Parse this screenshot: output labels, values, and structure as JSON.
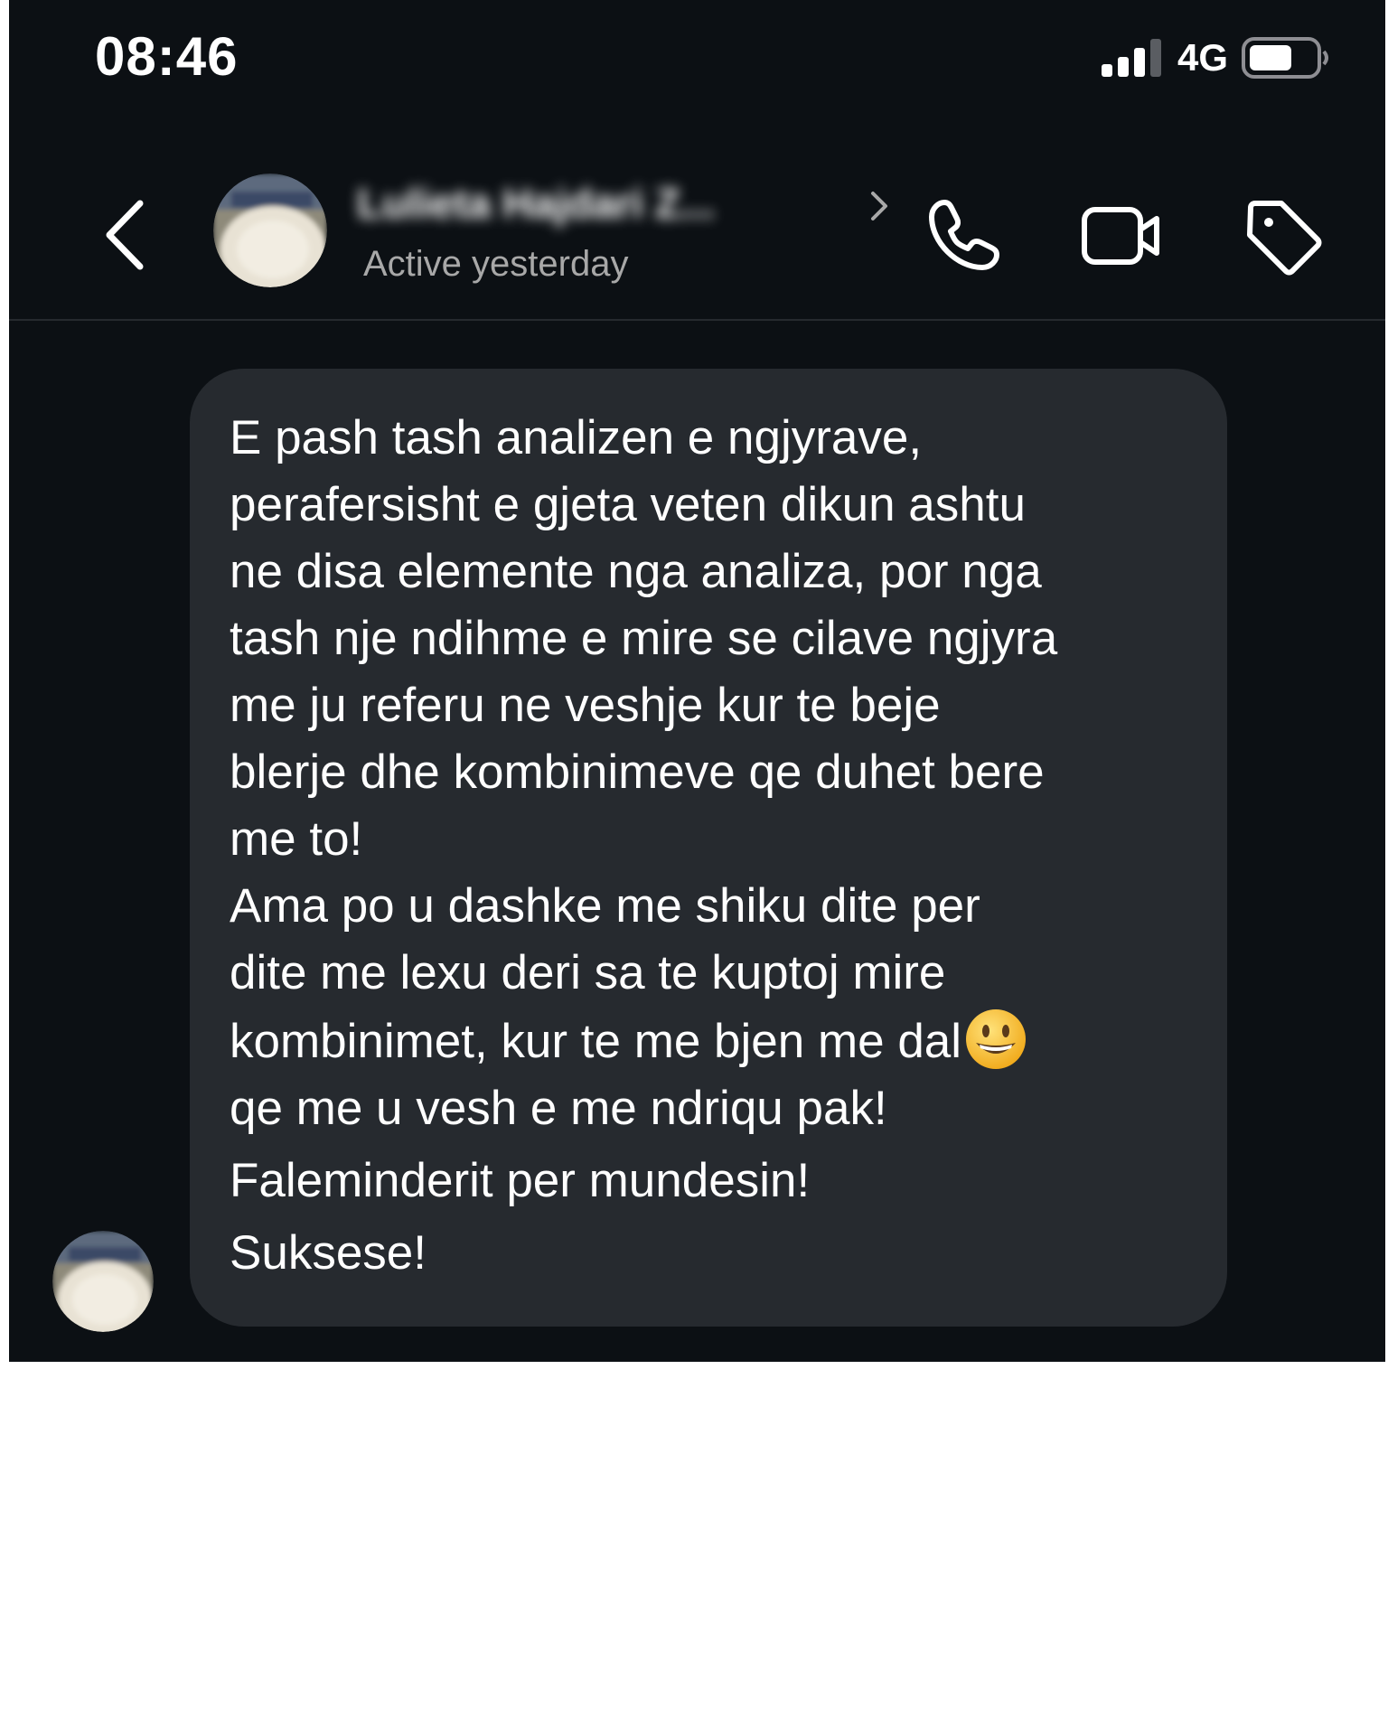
{
  "status_bar": {
    "time": "08:46",
    "network": "4G",
    "signal_icon": "signal-bars-icon",
    "battery_icon": "battery-icon",
    "battery_level": 0.6
  },
  "header": {
    "back_icon": "chevron-left-icon",
    "contact_name": "Lulieta Hajdari Z...",
    "contact_status": "Active yesterday",
    "actions": [
      "phone-icon",
      "video-camera-icon",
      "tag-icon"
    ]
  },
  "message": {
    "lines": [
      "E pash tash analizen e ngjyrave,",
      "perafersisht e gjeta veten dikun ashtu",
      "ne disa elemente nga analiza, por nga",
      "tash nje ndihme e mire se cilave ngjyra",
      "me ju referu ne veshje kur te beje",
      "blerje dhe kombinimeve qe duhet bere",
      "me to!",
      "Ama po u dashke me shiku dite per",
      "dite me lexu deri sa te kuptoj mire",
      "kombinimet, kur te me bjen me dal",
      "qe me u vesh e me ndriqu pak!",
      "Faleminderit per mundesin!",
      "Suksese!"
    ],
    "emoji": "grinning-face-emoji"
  },
  "colors": {
    "background": "#0c1014",
    "bubble": "#262a2f",
    "text": "#ffffff",
    "secondary_text": "#a8a8a8"
  }
}
